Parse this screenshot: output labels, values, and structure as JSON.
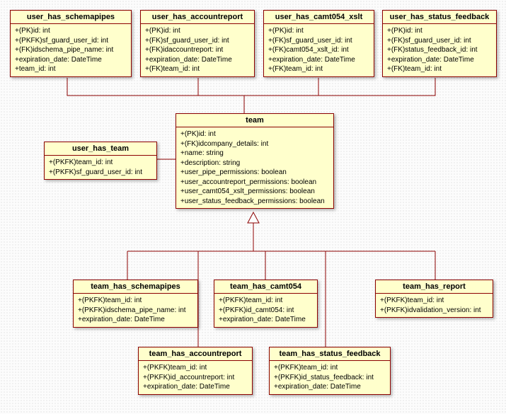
{
  "entities": {
    "user_has_schemapipes": {
      "title": "user_has_schemapipes",
      "attrs": [
        "+(PK)id: int",
        "+(PKFK)sf_guard_user_id: int",
        "+(FK)idschema_pipe_name: int",
        "+expiration_date: DateTime",
        "+team_id: int"
      ]
    },
    "user_has_accountreport": {
      "title": "user_has_accountreport",
      "attrs": [
        "+(PK)id: int",
        "+(FK)sf_guard_user_id: int",
        "+(FK)idaccountreport: int",
        "+expiration_date: DateTime",
        "+(FK)team_id: int"
      ]
    },
    "user_has_camt054_xslt": {
      "title": "user_has_camt054_xslt",
      "attrs": [
        "+(PK)id: int",
        "+(FK)sf_guard_user_id: int",
        "+(FK)camt054_xslt_id: int",
        "+expiration_date: DateTime",
        "+(FK)team_id: int"
      ]
    },
    "user_has_status_feedback": {
      "title": "user_has_status_feedback",
      "attrs": [
        "+(PK)id: int",
        "+(FK)sf_guard_user_id: int",
        "+(FK)status_feedback_id: int",
        "+expiration_date: DateTime",
        "+(FK)team_id: int"
      ]
    },
    "user_has_team": {
      "title": "user_has_team",
      "attrs": [
        "+(PKFK)team_id: int",
        "+(PKFK)sf_guard_user_id: int"
      ]
    },
    "team": {
      "title": "team",
      "attrs": [
        "+(PK)id: int",
        "+(FK)idcompany_details: int",
        "+name: string",
        "+description: string",
        "+user_pipe_permissions: boolean",
        "+user_accountreport_permissions: boolean",
        "+user_camt054_xslt_permissions: boolean",
        "+user_status_feedback_permissions: boolean"
      ]
    },
    "team_has_schemapipes": {
      "title": "team_has_schemapipes",
      "attrs": [
        "+(PKFK)team_id: int",
        "+(PKFK)idschema_pipe_name: int",
        "+expiration_date: DateTime"
      ]
    },
    "team_has_camt054": {
      "title": "team_has_camt054",
      "attrs": [
        "+(PKFK)team_id: int",
        "+(PKFK)id_camt054: int",
        "+expiration_date: DateTime"
      ]
    },
    "team_has_report": {
      "title": "team_has_report",
      "attrs": [
        "+(PKFK)team_id: int",
        "+(PKFK)idvalidation_version: int"
      ]
    },
    "team_has_accountreport": {
      "title": "team_has_accountreport",
      "attrs": [
        "+(PKFK)team_id: int",
        "+(PKFK)id_accountreport: int",
        "+expiration_date: DateTime"
      ]
    },
    "team_has_status_feedback": {
      "title": "team_has_status_feedback",
      "attrs": [
        "+(PKFK)team_id: int",
        "+(PKFK)id_status_feedback: int",
        "+expiration_date: DateTime"
      ]
    }
  }
}
